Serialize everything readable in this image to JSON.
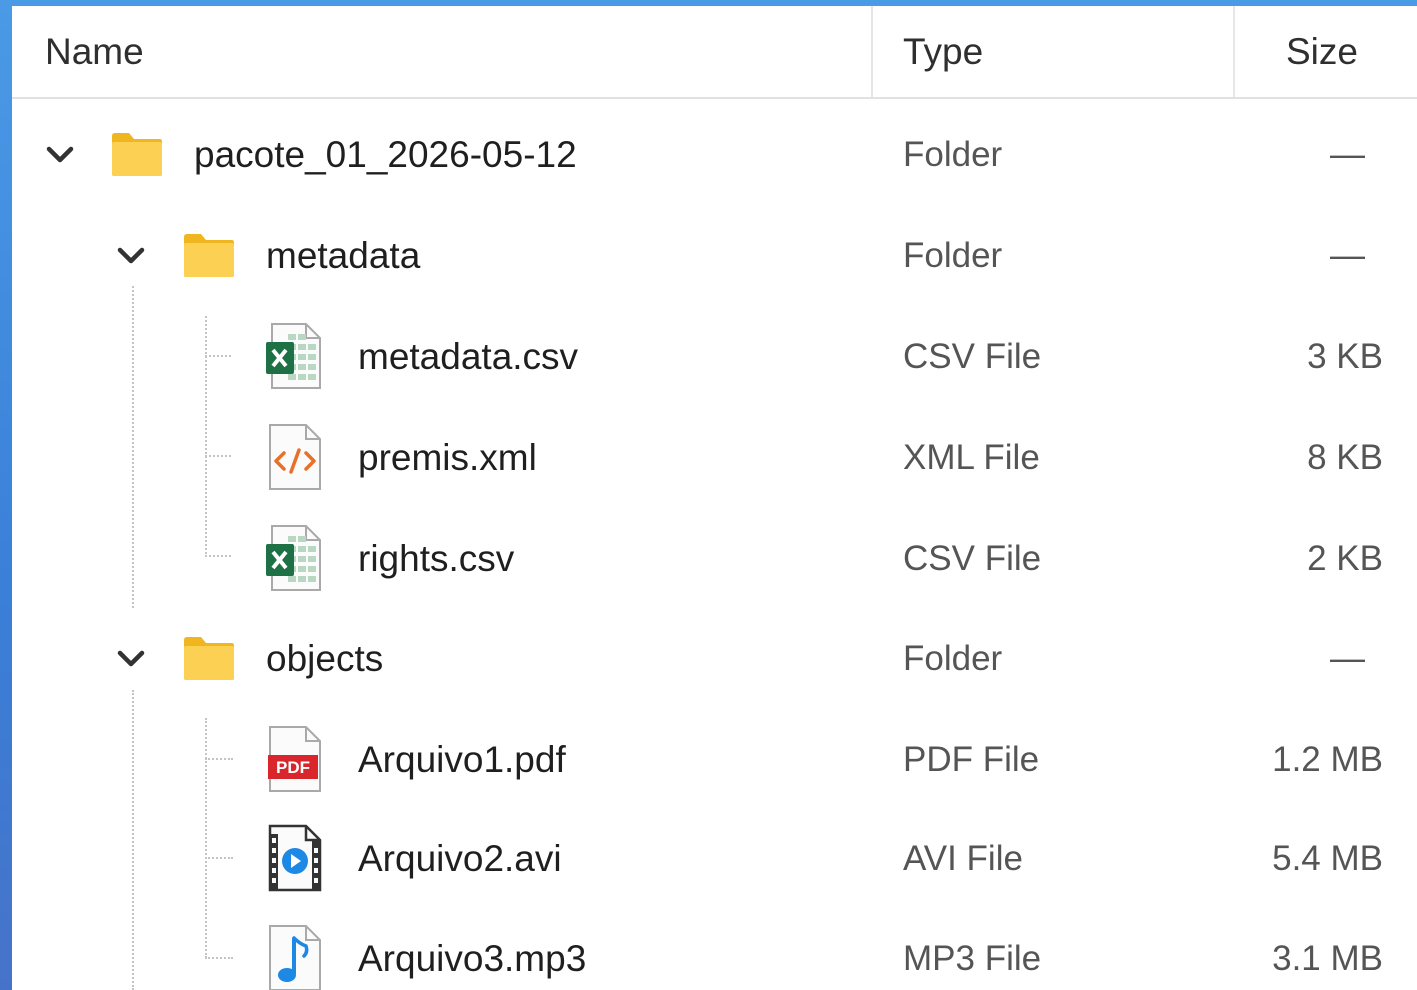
{
  "columns": {
    "name": "Name",
    "type": "Type",
    "size": "Size"
  },
  "colors": {
    "folder": "#fcc836",
    "excel": "#1e7145",
    "pdf": "#d9262c",
    "media": "#1e88e5",
    "code": "#e8712a"
  },
  "rows": [
    {
      "name": "pacote_01_2026-05-12",
      "type": "Folder",
      "size": "—",
      "icon": "folder-icon",
      "expanded": true
    },
    {
      "name": "metadata",
      "type": "Folder",
      "size": "—",
      "icon": "folder-icon",
      "expanded": true
    },
    {
      "name": "metadata.csv",
      "type": "CSV File",
      "size": "3 KB",
      "icon": "csv-file-icon"
    },
    {
      "name": "premis.xml",
      "type": "XML File",
      "size": "8 KB",
      "icon": "xml-file-icon"
    },
    {
      "name": "rights.csv",
      "type": "CSV File",
      "size": "2 KB",
      "icon": "csv-file-icon"
    },
    {
      "name": "objects",
      "type": "Folder",
      "size": "—",
      "icon": "folder-icon",
      "expanded": true
    },
    {
      "name": "Arquivo1.pdf",
      "type": "PDF File",
      "size": "1.2 MB",
      "icon": "pdf-file-icon"
    },
    {
      "name": "Arquivo2.avi",
      "type": "AVI File",
      "size": "5.4 MB",
      "icon": "video-file-icon"
    },
    {
      "name": "Arquivo3.mp3",
      "type": "MP3 File",
      "size": "3.1 MB",
      "icon": "audio-file-icon"
    }
  ]
}
